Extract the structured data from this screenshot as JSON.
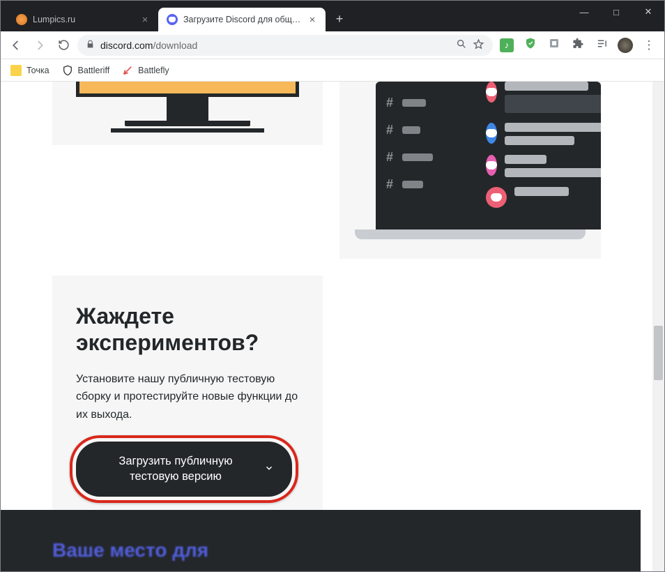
{
  "tabs": [
    {
      "title": "Lumpics.ru",
      "active": false
    },
    {
      "title": "Загрузите Discord для общения",
      "active": true
    }
  ],
  "address": {
    "host": "discord.com",
    "path": "/download"
  },
  "bookmarks": [
    {
      "label": "Точка"
    },
    {
      "label": "Battleriff"
    },
    {
      "label": "Battlefly"
    }
  ],
  "ptb": {
    "heading": "Жаждете экспериментов?",
    "description": "Установите нашу публичную тестовую сборку и протестируйте новые функции до их выхода.",
    "button_label": "Загрузить публичную тестовую версию"
  },
  "footer": {
    "tagline": "Ваше место для"
  }
}
